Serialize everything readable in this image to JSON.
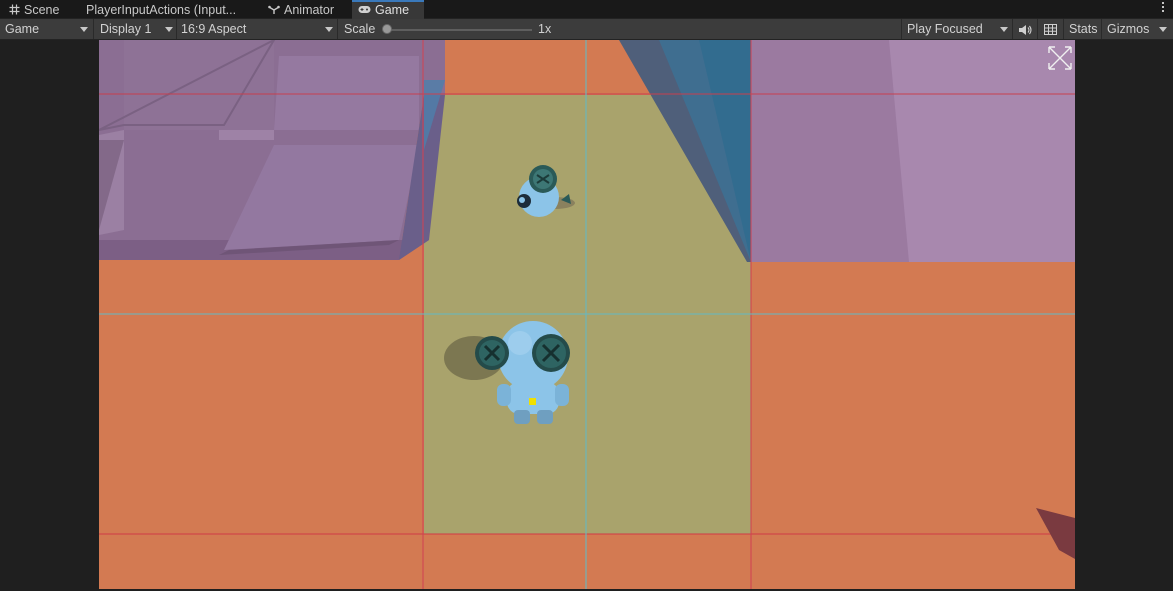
{
  "tabs": [
    {
      "label": "Scene",
      "icon": "grid-icon",
      "active": false
    },
    {
      "label": "PlayerInputActions (Input...",
      "icon": "",
      "active": false
    },
    {
      "label": "Animator",
      "icon": "animator-icon",
      "active": false
    },
    {
      "label": "Game",
      "icon": "gamepad-icon",
      "active": true
    }
  ],
  "toolbar": {
    "view_mode": "Game",
    "display": "Display 1",
    "aspect": "16:9 Aspect",
    "scale_label": "Scale",
    "scale_value": "1x",
    "scale_fraction": 0.0,
    "play_mode": "Play Focused",
    "stats_label": "Stats",
    "gizmos_label": "Gizmos",
    "icons": [
      "audio-icon",
      "grid-icon",
      "kebab-menu-icon"
    ]
  },
  "colors": {
    "tab_active_accent": "#3a79bb",
    "floor_orange": "#d77c53",
    "walkway_yellow": "#a9a36c",
    "wall_purple": "#8c6d96",
    "robot_blue": "#8cc4e8"
  }
}
